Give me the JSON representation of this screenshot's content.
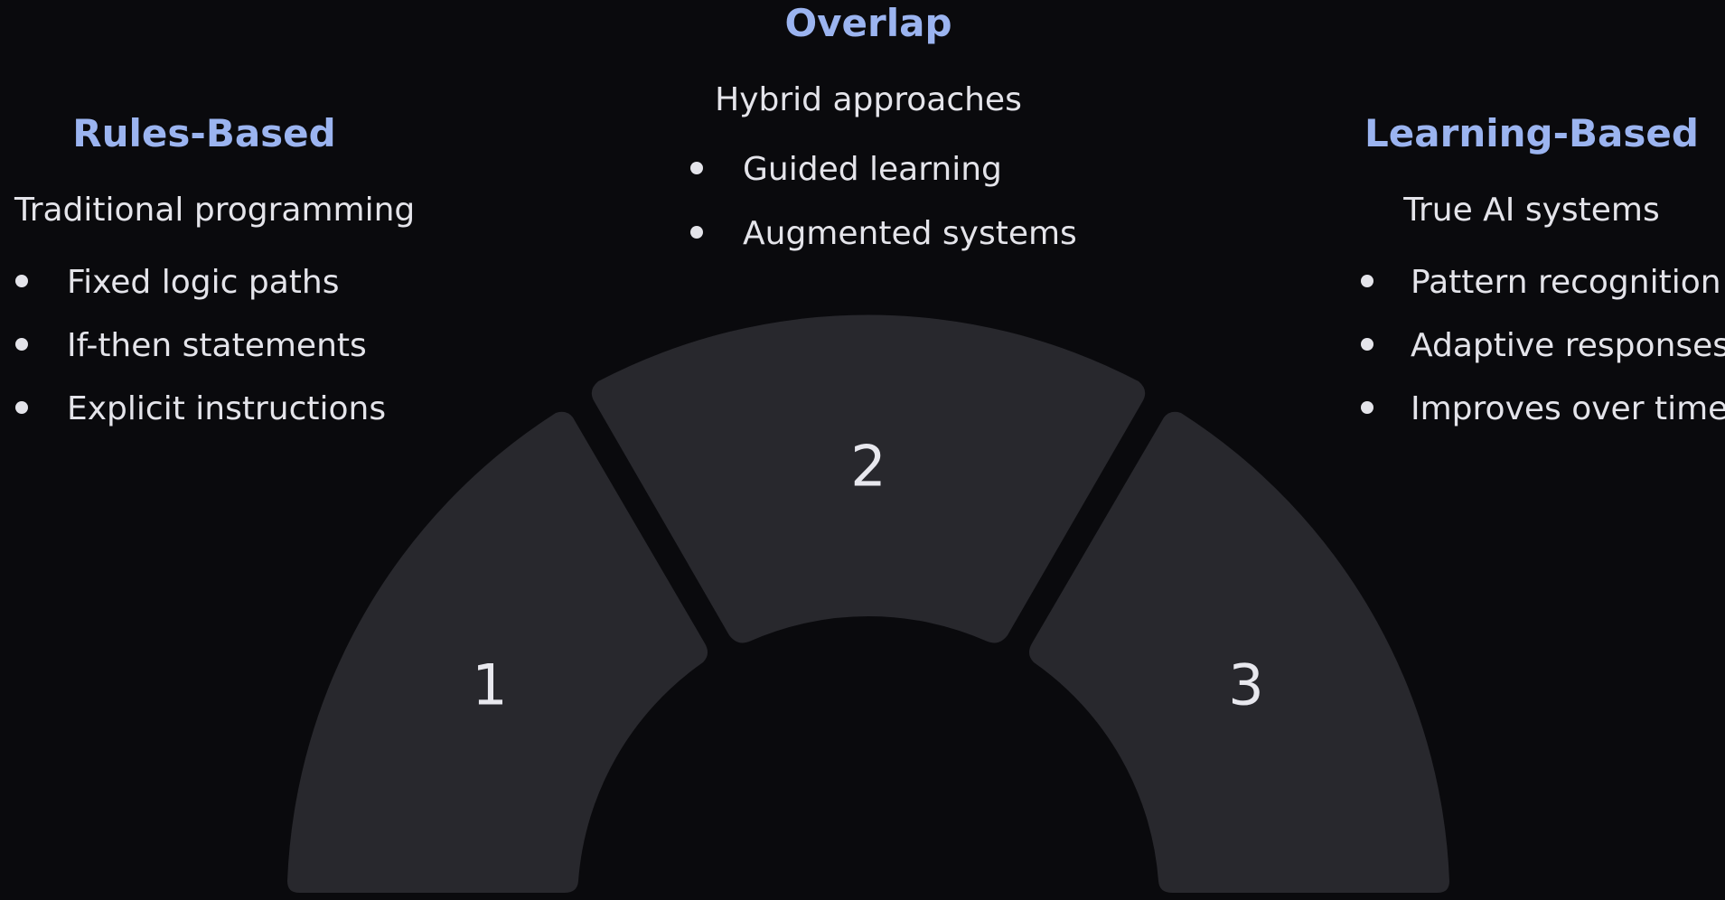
{
  "left": {
    "title": "Rules-Based",
    "subtitle": "Traditional programming",
    "items": [
      "Fixed logic paths",
      "If-then statements",
      "Explicit instructions"
    ]
  },
  "center": {
    "title": "Overlap",
    "subtitle": "Hybrid approaches",
    "items": [
      "Guided learning",
      "Augmented systems"
    ]
  },
  "right": {
    "title": "Learning-Based",
    "subtitle": "True AI systems",
    "items": [
      "Pattern recognition",
      "Adaptive responses",
      "Improves over time"
    ]
  },
  "segments": [
    "1",
    "2",
    "3"
  ],
  "colors": {
    "background": "#0a0a0d",
    "heading": "#9bb4f0",
    "text": "#e4e4ea",
    "segment_fill": "#28282d"
  }
}
